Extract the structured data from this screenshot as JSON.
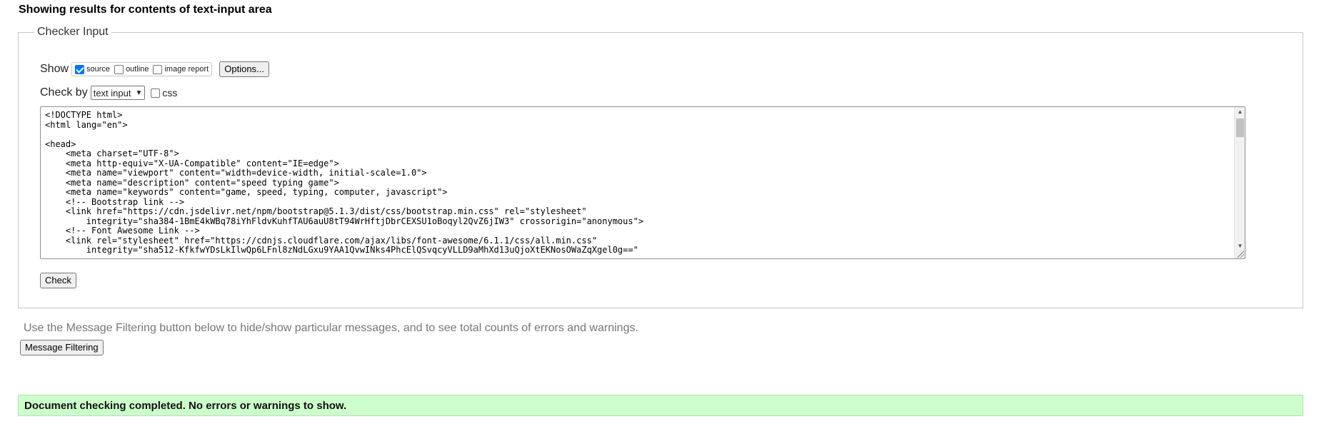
{
  "page_title": "Showing results for contents of text-input area",
  "checker": {
    "legend": "Checker Input",
    "show_label": "Show",
    "options": [
      {
        "label": "source",
        "checked": true
      },
      {
        "label": "outline",
        "checked": false
      },
      {
        "label": "image report",
        "checked": false
      }
    ],
    "options_button": "Options...",
    "check_by_label": "Check by",
    "check_by_value": "text input",
    "css_label": "css",
    "css_checked": false,
    "source_text": "<!DOCTYPE html>\n<html lang=\"en\">\n\n<head>\n    <meta charset=\"UTF-8\">\n    <meta http-equiv=\"X-UA-Compatible\" content=\"IE=edge\">\n    <meta name=\"viewport\" content=\"width=device-width, initial-scale=1.0\">\n    <meta name=\"description\" content=\"speed typing game\">\n    <meta name=\"keywords\" content=\"game, speed, typing, computer, javascript\">\n    <!-- Bootstrap link -->\n    <link href=\"https://cdn.jsdelivr.net/npm/bootstrap@5.1.3/dist/css/bootstrap.min.css\" rel=\"stylesheet\"\n        integrity=\"sha384-1BmE4kWBq78iYhFldvKuhfTAU6auU8tT94WrHftjDbrCEXSU1oBoqyl2QvZ6jIW3\" crossorigin=\"anonymous\">\n    <!-- Font Awesome Link -->\n    <link rel=\"stylesheet\" href=\"https://cdnjs.cloudflare.com/ajax/libs/font-awesome/6.1.1/css/all.min.css\"\n        integrity=\"sha512-KfkfwYDsLkIlwQp6LFnl8zNdLGxu9YAA1QvwINks4PhcElQSvqcyVLLD9aMhXd13uQjoXtEKNosOWaZqXgel0g==\"",
    "check_button": "Check"
  },
  "hint_text": "Use the Message Filtering button below to hide/show particular messages, and to see total counts of errors and warnings.",
  "message_filtering_button": "Message Filtering",
  "result_message": "Document checking completed. No errors or warnings to show.",
  "colors": {
    "success_bg": "#ccffcc",
    "checkbox_accent": "#0075ff"
  }
}
